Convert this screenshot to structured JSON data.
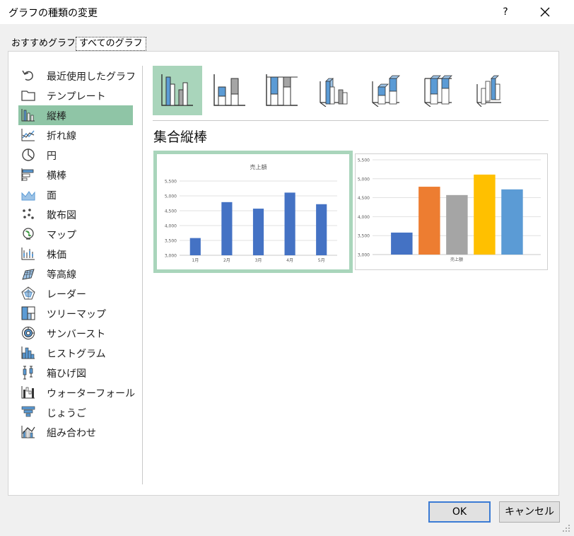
{
  "dialog": {
    "title": "グラフの種類の変更",
    "help_label": "?"
  },
  "tabs": [
    {
      "label": "おすすめグラフ"
    },
    {
      "label": "すべてのグラフ"
    }
  ],
  "sidebar": {
    "items": [
      {
        "label": "最近使用したグラフ",
        "icon": "undo-icon"
      },
      {
        "label": "テンプレート",
        "icon": "folder-icon"
      },
      {
        "label": "縦棒",
        "icon": "column-chart-icon",
        "selected": true
      },
      {
        "label": "折れ線",
        "icon": "line-chart-icon"
      },
      {
        "label": "円",
        "icon": "pie-chart-icon"
      },
      {
        "label": "横棒",
        "icon": "bar-chart-icon"
      },
      {
        "label": "面",
        "icon": "area-chart-icon"
      },
      {
        "label": "散布図",
        "icon": "scatter-chart-icon"
      },
      {
        "label": "マップ",
        "icon": "map-chart-icon"
      },
      {
        "label": "株価",
        "icon": "stock-chart-icon"
      },
      {
        "label": "等高線",
        "icon": "surface-chart-icon"
      },
      {
        "label": "レーダー",
        "icon": "radar-chart-icon"
      },
      {
        "label": "ツリーマップ",
        "icon": "treemap-chart-icon"
      },
      {
        "label": "サンバースト",
        "icon": "sunburst-chart-icon"
      },
      {
        "label": "ヒストグラム",
        "icon": "histogram-chart-icon"
      },
      {
        "label": "箱ひげ図",
        "icon": "box-whisker-chart-icon"
      },
      {
        "label": "ウォーターフォール",
        "icon": "waterfall-chart-icon"
      },
      {
        "label": "じょうご",
        "icon": "funnel-chart-icon"
      },
      {
        "label": "組み合わせ",
        "icon": "combo-chart-icon"
      }
    ]
  },
  "subtypes": [
    {
      "icon": "clustered-column-icon",
      "selected": true
    },
    {
      "icon": "stacked-column-icon"
    },
    {
      "icon": "stacked-100-column-icon"
    },
    {
      "icon": "3d-clustered-column-icon"
    },
    {
      "icon": "3d-stacked-column-icon"
    },
    {
      "icon": "3d-stacked-100-column-icon"
    },
    {
      "icon": "3d-column-icon"
    }
  ],
  "main": {
    "heading": "集合縦棒"
  },
  "chart_data": [
    {
      "type": "bar",
      "title": "売上額",
      "categories": [
        "1月",
        "2月",
        "3月",
        "4月",
        "5月"
      ],
      "values": [
        3580,
        4790,
        4570,
        5110,
        4720
      ],
      "ylim": [
        3000,
        5500
      ],
      "yticks": [
        "3,000",
        "3,500",
        "4,000",
        "4,500",
        "5,000",
        "5,500"
      ],
      "color": "#4472c4",
      "grid": true
    },
    {
      "type": "bar",
      "title": "",
      "categories": [
        "売上額"
      ],
      "series": [
        {
          "values": [
            3580
          ],
          "color": "#4472c4"
        },
        {
          "values": [
            4790
          ],
          "color": "#ed7d31"
        },
        {
          "values": [
            4570
          ],
          "color": "#a5a5a5"
        },
        {
          "values": [
            5110
          ],
          "color": "#ffc000"
        },
        {
          "values": [
            4720
          ],
          "color": "#5b9bd5"
        }
      ],
      "ylim": [
        3000,
        5500
      ],
      "yticks": [
        "3,000",
        "3,500",
        "4,000",
        "4,500",
        "5,000",
        "5,500"
      ],
      "grid": true
    }
  ],
  "buttons": {
    "ok_label": "OK",
    "cancel_label": "キャンセル"
  },
  "colors": {
    "selection": "#8fc5a6",
    "selection_light": "#a9d5bb",
    "icon_blue": "#5b9bd5",
    "ok_border": "#3b7bd4"
  }
}
